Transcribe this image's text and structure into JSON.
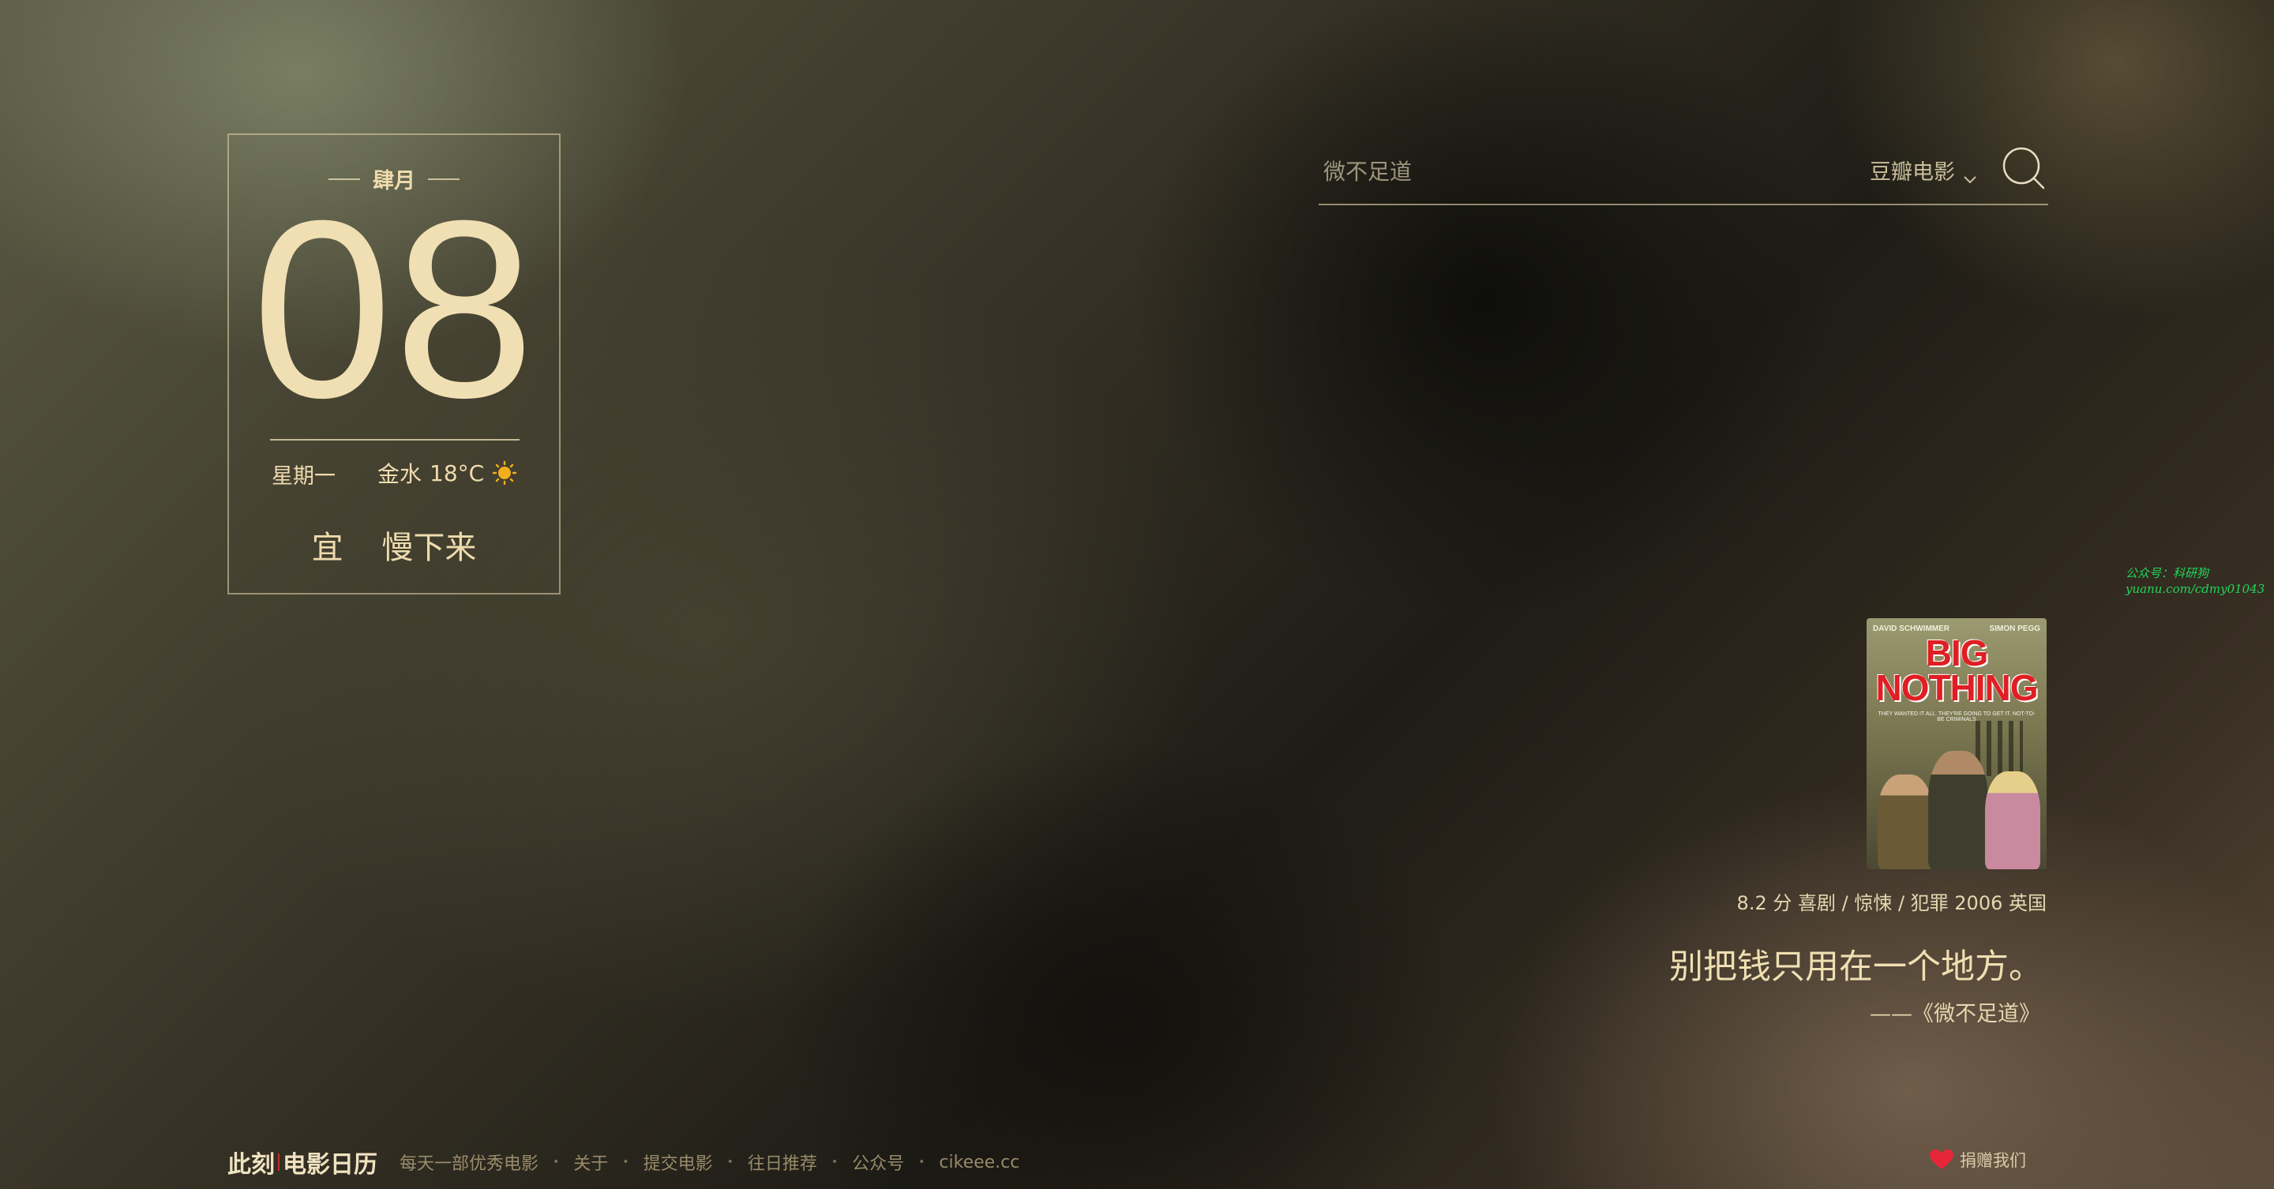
{
  "calendar": {
    "month": "肆月",
    "day": "08",
    "weekday": "星期一",
    "weather_location": "金水",
    "temperature": "18°C",
    "weather_icon": "sun-icon",
    "yi_label": "宜",
    "yi_text": "慢下来"
  },
  "search": {
    "placeholder": "微不足道",
    "engine": "豆瓣电影",
    "icons": {
      "search": "search-icon",
      "dropdown": "chevron-down-icon"
    }
  },
  "watermark": {
    "line1": "公众号：科研狗",
    "line2": "yuanu.com/cdmy01043"
  },
  "movie": {
    "poster": {
      "credit_left": "DAVID SCHWIMMER",
      "credit_right": "SIMON PEGG",
      "title_line1": "BIG",
      "title_line2": "NOTHING",
      "tagline": "THEY WANTED IT ALL. THEY'RE GOING TO GET IT. NOT-TO-BE CRIMINALS"
    },
    "meta": "8.2 分 喜剧 / 惊悚 / 犯罪 2006 英国",
    "quote": "别把钱只用在一个地方。",
    "source": "——《微不足道》"
  },
  "footer": {
    "brand_part1": "此刻",
    "brand_part2": "电影日历",
    "links": [
      "每天一部优秀电影",
      "关于",
      "提交电影",
      "往日推荐",
      "公众号",
      "cikeee.cc"
    ],
    "separator": "•",
    "donate": "捐赠我们"
  },
  "colors": {
    "accent_text": "#efdcae",
    "brand_red": "#c72b2b",
    "watermark_green": "#1fd65a",
    "sun": "#f2b01e"
  }
}
